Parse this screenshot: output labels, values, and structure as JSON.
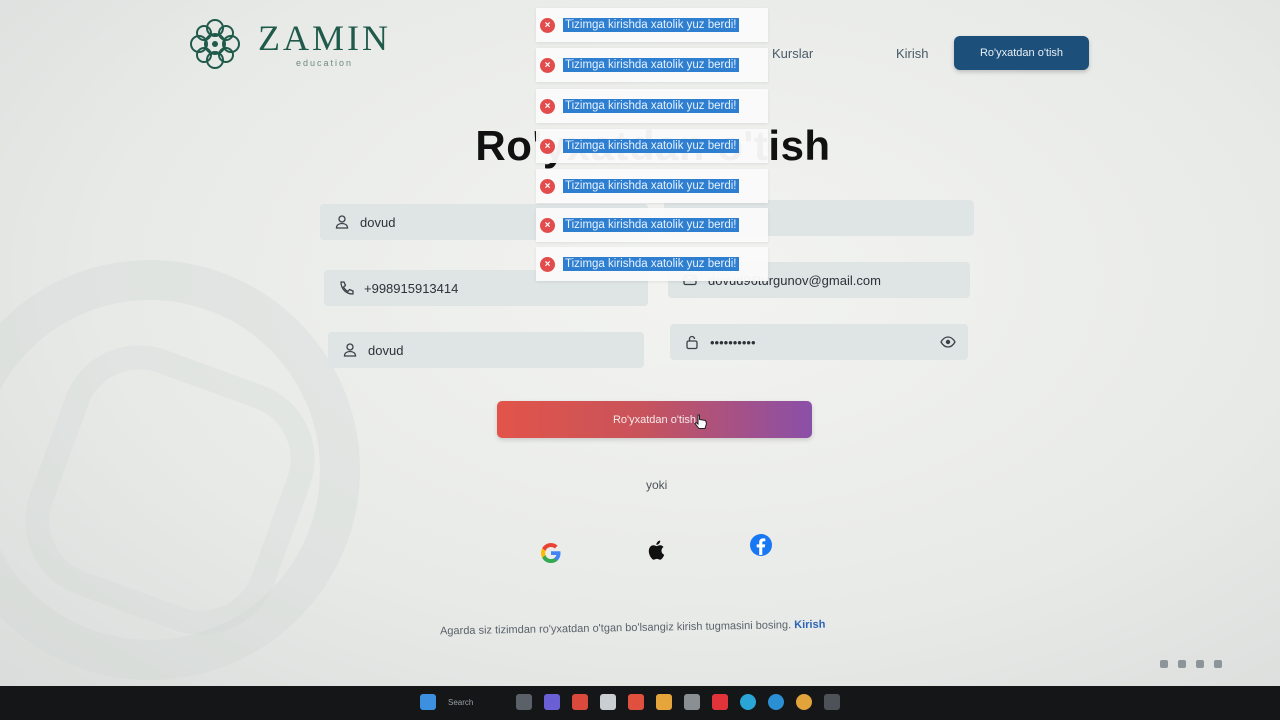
{
  "header": {
    "logo_title": "ZAMIN",
    "logo_subtitle": "education",
    "nav": [
      {
        "label": "Kurslar"
      },
      {
        "label": "Kirish"
      }
    ],
    "register_button": "Ro'yxatdan o'tish"
  },
  "page_title": "Ro'yxatdan o'tish",
  "toasts": [
    {
      "text": "Tizimga kirishda xatolik yuz berdi!"
    },
    {
      "text": "Tizimga kirishda xatolik yuz berdi!"
    },
    {
      "text": "Tizimga kirishda xatolik yuz berdi!"
    },
    {
      "text": "Tizimga kirishda xatolik yuz berdi!"
    },
    {
      "text": "Tizimga kirishda xatolik yuz berdi!"
    },
    {
      "text": "Tizimga kirishda xatolik yuz berdi!"
    },
    {
      "text": "Tizimga kirishda xatolik yuz berdi!"
    }
  ],
  "form": {
    "first_name": {
      "value": "dovud",
      "icon": "user-icon"
    },
    "phone": {
      "value": "+998915913414",
      "icon": "phone-icon"
    },
    "email": {
      "value": "dovud96turgunov@gmail.com",
      "icon": "mail-icon"
    },
    "username": {
      "value": "dovud",
      "icon": "user-icon"
    },
    "password": {
      "value": "••••••••••",
      "icon": "lock-icon"
    },
    "submit_label": "Ro'yxatdan o'tish"
  },
  "divider_text": "yoki",
  "social": [
    "google-icon",
    "apple-icon",
    "facebook-icon"
  ],
  "footer": {
    "note": "Agarda siz tizimdan ro'yxatdan o'tgan bo'lsangiz kirish tugmasini bosing.",
    "link": "Kirish"
  },
  "taskbar": {
    "search_label": "Search"
  },
  "colors": {
    "brand_green": "#1f5a4a",
    "nav_button": "#1c4f7a",
    "error_red": "#e24c4c",
    "selection_blue": "#2f7fd0",
    "link_blue": "#2a64b6"
  }
}
